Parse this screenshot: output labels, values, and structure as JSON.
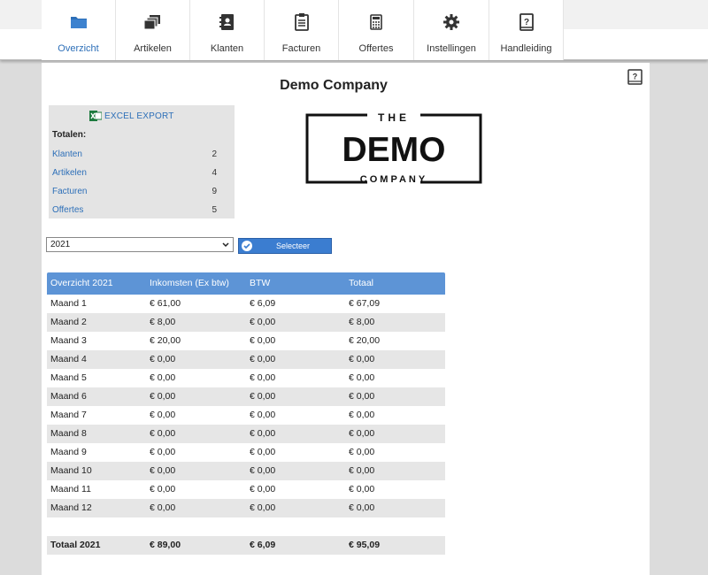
{
  "nav": {
    "items": [
      {
        "label": "Overzicht",
        "icon": "folder-icon",
        "active": true
      },
      {
        "label": "Artikelen",
        "icon": "stack-icon",
        "active": false
      },
      {
        "label": "Klanten",
        "icon": "address-book-icon",
        "active": false
      },
      {
        "label": "Facturen",
        "icon": "clipboard-icon",
        "active": false
      },
      {
        "label": "Offertes",
        "icon": "calculator-icon",
        "active": false
      },
      {
        "label": "Instellingen",
        "icon": "gear-icon",
        "active": false
      },
      {
        "label": "Handleiding",
        "icon": "help-book-icon",
        "active": false
      }
    ]
  },
  "page": {
    "title": "Demo Company"
  },
  "logo": {
    "line_top": "THE",
    "line_main": "DEMO",
    "line_bottom": "COMPANY"
  },
  "stats": {
    "excel_label": "EXCEL EXPORT",
    "totals_label": "Totalen:",
    "rows": [
      {
        "label": "Klanten",
        "value": "2"
      },
      {
        "label": "Artikelen",
        "value": "4"
      },
      {
        "label": "Facturen",
        "value": "9"
      },
      {
        "label": "Offertes",
        "value": "5"
      }
    ]
  },
  "filter": {
    "year": "2021",
    "button_label": "Selecteer"
  },
  "table": {
    "headers": [
      "Overzicht 2021",
      "Inkomsten (Ex btw)",
      "BTW",
      "Totaal"
    ],
    "rows": [
      [
        "Maand 1",
        "€ 61,00",
        "€ 6,09",
        "€ 67,09"
      ],
      [
        "Maand 2",
        "€ 8,00",
        "€ 0,00",
        "€ 8,00"
      ],
      [
        "Maand 3",
        "€ 20,00",
        "€ 0,00",
        "€ 20,00"
      ],
      [
        "Maand 4",
        "€ 0,00",
        "€ 0,00",
        "€ 0,00"
      ],
      [
        "Maand 5",
        "€ 0,00",
        "€ 0,00",
        "€ 0,00"
      ],
      [
        "Maand 6",
        "€ 0,00",
        "€ 0,00",
        "€ 0,00"
      ],
      [
        "Maand 7",
        "€ 0,00",
        "€ 0,00",
        "€ 0,00"
      ],
      [
        "Maand 8",
        "€ 0,00",
        "€ 0,00",
        "€ 0,00"
      ],
      [
        "Maand 9",
        "€ 0,00",
        "€ 0,00",
        "€ 0,00"
      ],
      [
        "Maand 10",
        "€ 0,00",
        "€ 0,00",
        "€ 0,00"
      ],
      [
        "Maand 11",
        "€ 0,00",
        "€ 0,00",
        "€ 0,00"
      ],
      [
        "Maand 12",
        "€ 0,00",
        "€ 0,00",
        "€ 0,00"
      ]
    ],
    "total": [
      "Totaal 2021",
      "€ 89,00",
      "€ 6,09",
      "€ 95,09"
    ]
  },
  "colors": {
    "accent": "#2d6fb8",
    "header_bg": "#5d94d6",
    "row_alt": "#e6e6e6",
    "button": "#3b7dd0"
  }
}
